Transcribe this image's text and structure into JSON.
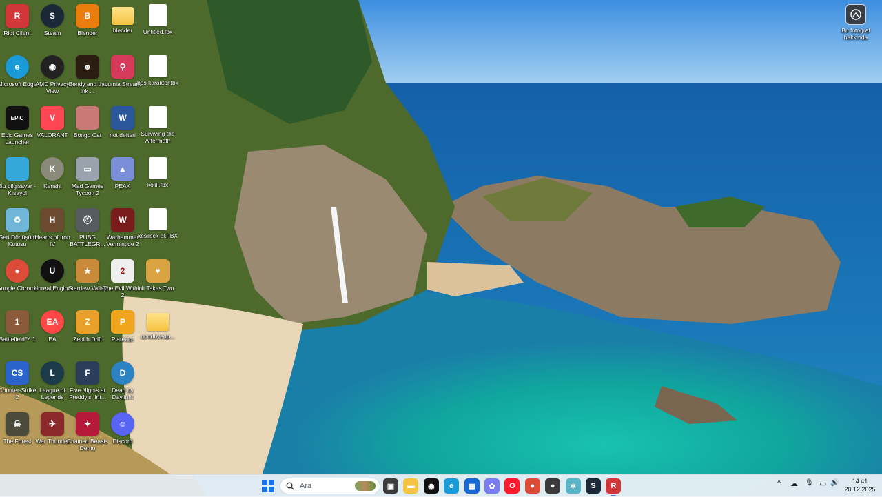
{
  "desktop": {
    "icons": [
      {
        "label": "Riot Client",
        "icon": "riot-icon",
        "color": "#d13639",
        "glyph": "R"
      },
      {
        "label": "Steam",
        "icon": "steam-icon",
        "color": "#1b2838",
        "glyph": "S"
      },
      {
        "label": "Blender",
        "icon": "blender-icon",
        "color": "#e87d0d",
        "glyph": "B"
      },
      {
        "label": "blender",
        "icon": "folder-icon",
        "color": "#f5c342",
        "glyph": ""
      },
      {
        "label": "Untitled.fbx",
        "icon": "file-icon",
        "color": "#ffffff",
        "glyph": ""
      },
      {
        "label": "Microsoft Edge",
        "icon": "edge-icon",
        "color": "#1a9bd7",
        "glyph": "e"
      },
      {
        "label": "AMD Privacy View",
        "icon": "amd-privacy-icon",
        "color": "#222222",
        "glyph": "◉"
      },
      {
        "label": "Bendy and the Ink ...",
        "icon": "bendy-icon",
        "color": "#2b1d12",
        "glyph": "☻"
      },
      {
        "label": "Lumia Stream",
        "icon": "lumia-icon",
        "color": "#d63a5a",
        "glyph": "⚲"
      },
      {
        "label": "boş karakter.fbx",
        "icon": "file-icon",
        "color": "#ffffff",
        "glyph": ""
      },
      {
        "label": "Epic Games Launcher",
        "icon": "epic-games-icon",
        "color": "#111111",
        "glyph": "EPIC"
      },
      {
        "label": "VALORANT",
        "icon": "valorant-icon",
        "color": "#ff4655",
        "glyph": "V"
      },
      {
        "label": "Bongo Cat",
        "icon": "bongo-cat-icon",
        "color": "#c97a76",
        "glyph": ""
      },
      {
        "label": "not defteri",
        "icon": "word-icon",
        "color": "#2b579a",
        "glyph": "W"
      },
      {
        "label": "Surviving the Aftermath",
        "icon": "file-icon",
        "color": "#ffffff",
        "glyph": ""
      },
      {
        "label": "Bu bilgisayar - Kısayol",
        "icon": "this-pc-icon",
        "color": "#35a7d8",
        "glyph": ""
      },
      {
        "label": "Kenshi",
        "icon": "kenshi-icon",
        "color": "#8a8a7a",
        "glyph": "K"
      },
      {
        "label": "Mad Games Tycoon 2",
        "icon": "mad-games-icon",
        "color": "#9aa3ad",
        "glyph": "▭"
      },
      {
        "label": "PEAK",
        "icon": "peak-icon",
        "color": "#7b8fd8",
        "glyph": "▲"
      },
      {
        "label": "kolili.fbx",
        "icon": "file-icon",
        "color": "#ffffff",
        "glyph": ""
      },
      {
        "label": "Geri Dönüşüm Kutusu",
        "icon": "recycle-bin-icon",
        "color": "#6fb6d9",
        "glyph": "♻"
      },
      {
        "label": "Hearts of Iron IV",
        "icon": "hoi4-icon",
        "color": "#6b4a2f",
        "glyph": "H"
      },
      {
        "label": "PUBG BATTLEGR...",
        "icon": "pubg-icon",
        "color": "#565b5f",
        "glyph": "⛑"
      },
      {
        "label": "Warhammer Vermintide 2",
        "icon": "vermintide-icon",
        "color": "#7a1c1c",
        "glyph": "W"
      },
      {
        "label": "kesileck el.FBX",
        "icon": "file-icon",
        "color": "#ffffff",
        "glyph": ""
      },
      {
        "label": "Google Chrome",
        "icon": "chrome-icon",
        "color": "#dd4b39",
        "glyph": "●"
      },
      {
        "label": "Unreal Engine",
        "icon": "unreal-icon",
        "color": "#111111",
        "glyph": "U"
      },
      {
        "label": "Stardew Valley",
        "icon": "stardew-icon",
        "color": "#c98b3a",
        "glyph": "★"
      },
      {
        "label": "The Evil Within 2",
        "icon": "evil-within-icon",
        "color": "#efefef",
        "glyph": "2"
      },
      {
        "label": "It Takes Two",
        "icon": "it-takes-two-icon",
        "color": "#d9a441",
        "glyph": "♥"
      },
      {
        "label": "Battlefield™ 1",
        "icon": "battlefield-icon",
        "color": "#8a5a3a",
        "glyph": "1"
      },
      {
        "label": "EA",
        "icon": "ea-icon",
        "color": "#ff4747",
        "glyph": "EA"
      },
      {
        "label": "Zenith Drift",
        "icon": "zenith-drift-icon",
        "color": "#e8a02a",
        "glyph": "Z"
      },
      {
        "label": "PlateUp!",
        "icon": "plateup-icon",
        "color": "#f0a51c",
        "glyph": "P"
      },
      {
        "label": "goodbyedp...",
        "icon": "folder-icon",
        "color": "#f5c342",
        "glyph": ""
      },
      {
        "label": "Counter-Strike 2",
        "icon": "cs2-icon",
        "color": "#2a63c9",
        "glyph": "CS"
      },
      {
        "label": "League of Legends",
        "icon": "lol-icon",
        "color": "#1c3a4a",
        "glyph": "L"
      },
      {
        "label": "Five Nights at Freddy's: Int...",
        "icon": "fnaf-icon",
        "color": "#2a3d5a",
        "glyph": "F"
      },
      {
        "label": "Dead by Daylight",
        "icon": "dbd-icon",
        "color": "#2d82c2",
        "glyph": "D"
      },
      {
        "label": "The Forest",
        "icon": "the-forest-icon",
        "color": "#4a4a3a",
        "glyph": "☠"
      },
      {
        "label": "War Thunder",
        "icon": "war-thunder-icon",
        "color": "#8a2a2a",
        "glyph": "✈"
      },
      {
        "label": "Chained Beasts Demo",
        "icon": "chained-beasts-icon",
        "color": "#b51a3a",
        "glyph": "✦"
      },
      {
        "label": "Discord",
        "icon": "discord-icon",
        "color": "#5865f2",
        "glyph": "☺"
      }
    ],
    "top_right": {
      "label": "Bu fotoğraf hakkında",
      "icon": "about-photo-icon"
    }
  },
  "taskbar": {
    "search_placeholder": "Ara",
    "apps": [
      {
        "name": "task-view",
        "icon": "task-view-icon",
        "color": "#3c3c3c",
        "glyph": "▣"
      },
      {
        "name": "file-explorer",
        "icon": "folder-icon",
        "color": "#f5c342",
        "glyph": "▬"
      },
      {
        "name": "media-app",
        "icon": "app-circle-icon",
        "color": "#111111",
        "glyph": "◉"
      },
      {
        "name": "edge",
        "icon": "edge-icon",
        "color": "#1a9bd7",
        "glyph": "e"
      },
      {
        "name": "microsoft-store",
        "icon": "store-icon",
        "color": "#1769d1",
        "glyph": "▦"
      },
      {
        "name": "copilot",
        "icon": "copilot-icon",
        "color": "#7a7cf0",
        "glyph": "✿"
      },
      {
        "name": "opera",
        "icon": "opera-icon",
        "color": "#ff1b2d",
        "glyph": "O"
      },
      {
        "name": "chrome",
        "icon": "chrome-icon",
        "color": "#dd4b39",
        "glyph": "●"
      },
      {
        "name": "recording-app",
        "icon": "record-icon",
        "color": "#3a3a3a",
        "glyph": "●"
      },
      {
        "name": "settings-app",
        "icon": "gear-icon",
        "color": "#5ab4c8",
        "glyph": "✲"
      },
      {
        "name": "steam",
        "icon": "steam-icon",
        "color": "#1b2838",
        "glyph": "S"
      },
      {
        "name": "riot-client",
        "icon": "riot-icon",
        "color": "#d13639",
        "glyph": "R"
      }
    ],
    "tray": {
      "chevron": "^",
      "cloud": "☁",
      "mic": "🎙",
      "display": "▭",
      "volume": "🔊"
    },
    "time": "14:41",
    "date": "20.12.2025"
  }
}
